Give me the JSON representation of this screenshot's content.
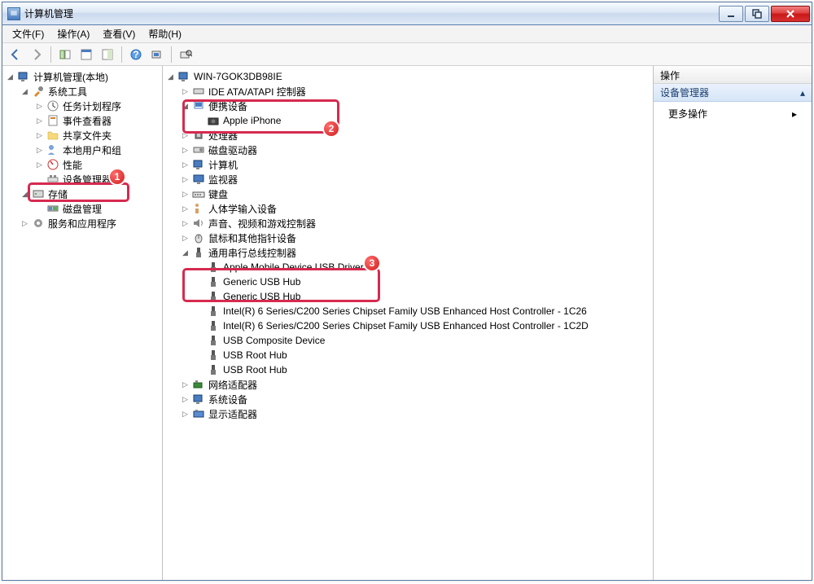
{
  "window": {
    "title": "计算机管理"
  },
  "menu": {
    "file": "文件(F)",
    "action": "操作(A)",
    "view": "查看(V)",
    "help": "帮助(H)"
  },
  "leftTree": {
    "root": "计算机管理(本地)",
    "sysTools": "系统工具",
    "taskSched": "任务计划程序",
    "eventViewer": "事件查看器",
    "sharedFolders": "共享文件夹",
    "localUsers": "本地用户和组",
    "performance": "性能",
    "deviceManager": "设备管理器",
    "storage": "存储",
    "diskMgmt": "磁盘管理",
    "services": "服务和应用程序"
  },
  "midTree": {
    "host": "WIN-7GOK3DB98IE",
    "ide": "IDE ATA/ATAPI 控制器",
    "portable": "便携设备",
    "iphone": "Apple iPhone",
    "processors": "处理器",
    "diskDrives": "磁盘驱动器",
    "computer": "计算机",
    "monitors": "监视器",
    "keyboards": "键盘",
    "hid": "人体学输入设备",
    "sound": "声音、视频和游戏控制器",
    "mice": "鼠标和其他指针设备",
    "usbControllers": "通用串行总线控制器",
    "appleUsb": "Apple Mobile Device USB Driver",
    "genericHub1": "Generic USB Hub",
    "genericHub2": "Generic USB Hub",
    "intel1": "Intel(R) 6 Series/C200 Series Chipset Family USB Enhanced Host Controller - 1C26",
    "intel2": "Intel(R) 6 Series/C200 Series Chipset Family USB Enhanced Host Controller - 1C2D",
    "composite": "USB Composite Device",
    "rootHub1": "USB Root Hub",
    "rootHub2": "USB Root Hub",
    "network": "网络适配器",
    "sysDevices": "系统设备",
    "display": "显示适配器"
  },
  "rightPane": {
    "header": "操作",
    "section": "设备管理器",
    "more": "更多操作"
  },
  "annotations": {
    "b1": "1",
    "b2": "2",
    "b3": "3"
  }
}
